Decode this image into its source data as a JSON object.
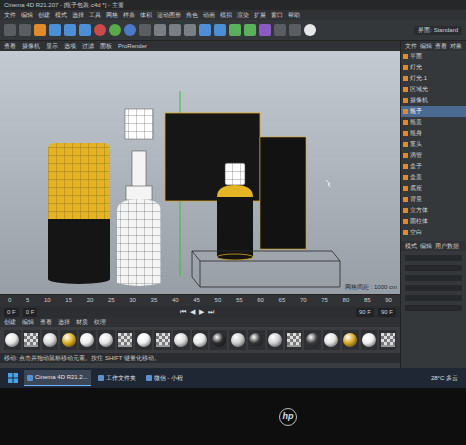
{
  "window": {
    "title": "Cinema 4D R21.207 - [瓶子包装.c4d *] - 主要"
  },
  "menu": [
    "文件",
    "编辑",
    "创建",
    "模式",
    "选择",
    "工具",
    "网格",
    "样条",
    "体积",
    "运动图形",
    "角色",
    "动画",
    "模拟",
    "渲染",
    "扩展",
    "窗口",
    "帮助"
  ],
  "layout_label": "界面: Standard",
  "viewport": {
    "menu": [
      "查看",
      "摄像机",
      "显示",
      "选项",
      "过滤",
      "面板",
      "ProRender"
    ],
    "grid": "网格间距 : 1000 cm"
  },
  "object_panel": {
    "menu": [
      "文件",
      "编辑",
      "查看",
      "对象"
    ],
    "items": [
      {
        "name": "平面",
        "selected": false
      },
      {
        "name": "灯光",
        "selected": false
      },
      {
        "name": "灯光.1",
        "selected": false
      },
      {
        "name": "区域光",
        "selected": false
      },
      {
        "name": "摄像机",
        "selected": false
      },
      {
        "name": "瓶子",
        "selected": true
      },
      {
        "name": "瓶盖",
        "selected": false
      },
      {
        "name": "瓶身",
        "selected": false
      },
      {
        "name": "泵头",
        "selected": false
      },
      {
        "name": "滴管",
        "selected": false
      },
      {
        "name": "盒子",
        "selected": false
      },
      {
        "name": "盒盖",
        "selected": false
      },
      {
        "name": "底座",
        "selected": false
      },
      {
        "name": "背景",
        "selected": false
      },
      {
        "name": "立方体",
        "selected": false
      },
      {
        "name": "圆柱体",
        "selected": false
      },
      {
        "name": "空白",
        "selected": false
      }
    ]
  },
  "attributes": {
    "menu": [
      "模式",
      "编辑",
      "用户数据"
    ]
  },
  "timeline": {
    "ticks": [
      "0",
      "5",
      "10",
      "15",
      "20",
      "25",
      "30",
      "35",
      "40",
      "45",
      "50",
      "55",
      "60",
      "65",
      "70",
      "75",
      "80",
      "85",
      "90"
    ],
    "fields": [
      "0 F",
      "0 F",
      "90 F",
      "90 F"
    ],
    "controls": [
      "⏮",
      "◀",
      "▶",
      "⏭"
    ]
  },
  "materials": {
    "menu": [
      "创建",
      "编辑",
      "查看",
      "选择",
      "材质",
      "纹理"
    ],
    "items": [
      {
        "kind": "sphere",
        "color": "#e6e6e6"
      },
      {
        "kind": "checker",
        "color": "#999999"
      },
      {
        "kind": "sphere",
        "color": "#d9d9d9"
      },
      {
        "kind": "sphere",
        "color": "#e0b020"
      },
      {
        "kind": "sphere",
        "color": "#f0f0f0"
      },
      {
        "kind": "sphere",
        "color": "#e6e6e6"
      },
      {
        "kind": "checker",
        "color": "#999999"
      },
      {
        "kind": "sphere",
        "color": "#f2f2f2"
      },
      {
        "kind": "checker",
        "color": "#999999"
      },
      {
        "kind": "sphere",
        "color": "#dcdcdc"
      },
      {
        "kind": "sphere",
        "color": "#e8e8e8"
      },
      {
        "kind": "sphere",
        "color": "#2a2a2a"
      },
      {
        "kind": "sphere",
        "color": "#cfcfcf"
      },
      {
        "kind": "sphere",
        "color": "#333333"
      },
      {
        "kind": "sphere",
        "color": "#d0d0d0"
      },
      {
        "kind": "checker",
        "color": "#999999"
      },
      {
        "kind": "sphere",
        "color": "#3a3a3a"
      },
      {
        "kind": "sphere",
        "color": "#e4e4e4"
      },
      {
        "kind": "sphere",
        "color": "#d8a820"
      },
      {
        "kind": "sphere",
        "color": "#f0f0f0"
      },
      {
        "kind": "checker",
        "color": "#999999"
      }
    ]
  },
  "status": "移动: 点击并拖动鼠标移动元素。按住 SHIFT 键量化移动。",
  "taskbar": {
    "apps": [
      {
        "label": "Cinema 4D R21.2...",
        "selected": true
      },
      {
        "label": "工作文件夹",
        "selected": false
      },
      {
        "label": "微信 - 小程",
        "selected": false
      }
    ],
    "weather": "28°C 多云"
  },
  "monitor": {
    "brand": "hp"
  }
}
